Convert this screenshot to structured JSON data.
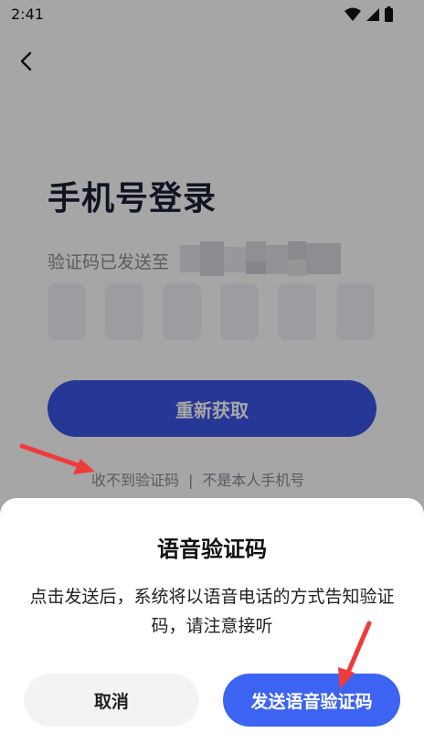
{
  "status_bar": {
    "time": "2:41",
    "icons": [
      "wifi-icon",
      "signal-icon",
      "battery-icon"
    ]
  },
  "header": {
    "back_icon": "chevron-left-icon"
  },
  "login": {
    "title": "手机号登录",
    "sent_prefix": "验证码已发送至",
    "code_digits": [
      "",
      "",
      "",
      "",
      "",
      ""
    ],
    "retry_label": "重新获取",
    "no_code_link": "收不到验证码",
    "separator": "|",
    "not_my_phone_link": "不是本人手机号"
  },
  "dialog": {
    "title": "语音验证码",
    "body": "点击发送后，系统将以语音电话的方式告知验证码，请注意接听",
    "cancel_label": "取消",
    "confirm_label": "发送语音验证码"
  },
  "colors": {
    "primary": "#3d55e6",
    "confirm": "#3d63f2",
    "annotation_arrow": "#f03b3b",
    "overlay": "rgba(0,0,0,0.35)"
  }
}
